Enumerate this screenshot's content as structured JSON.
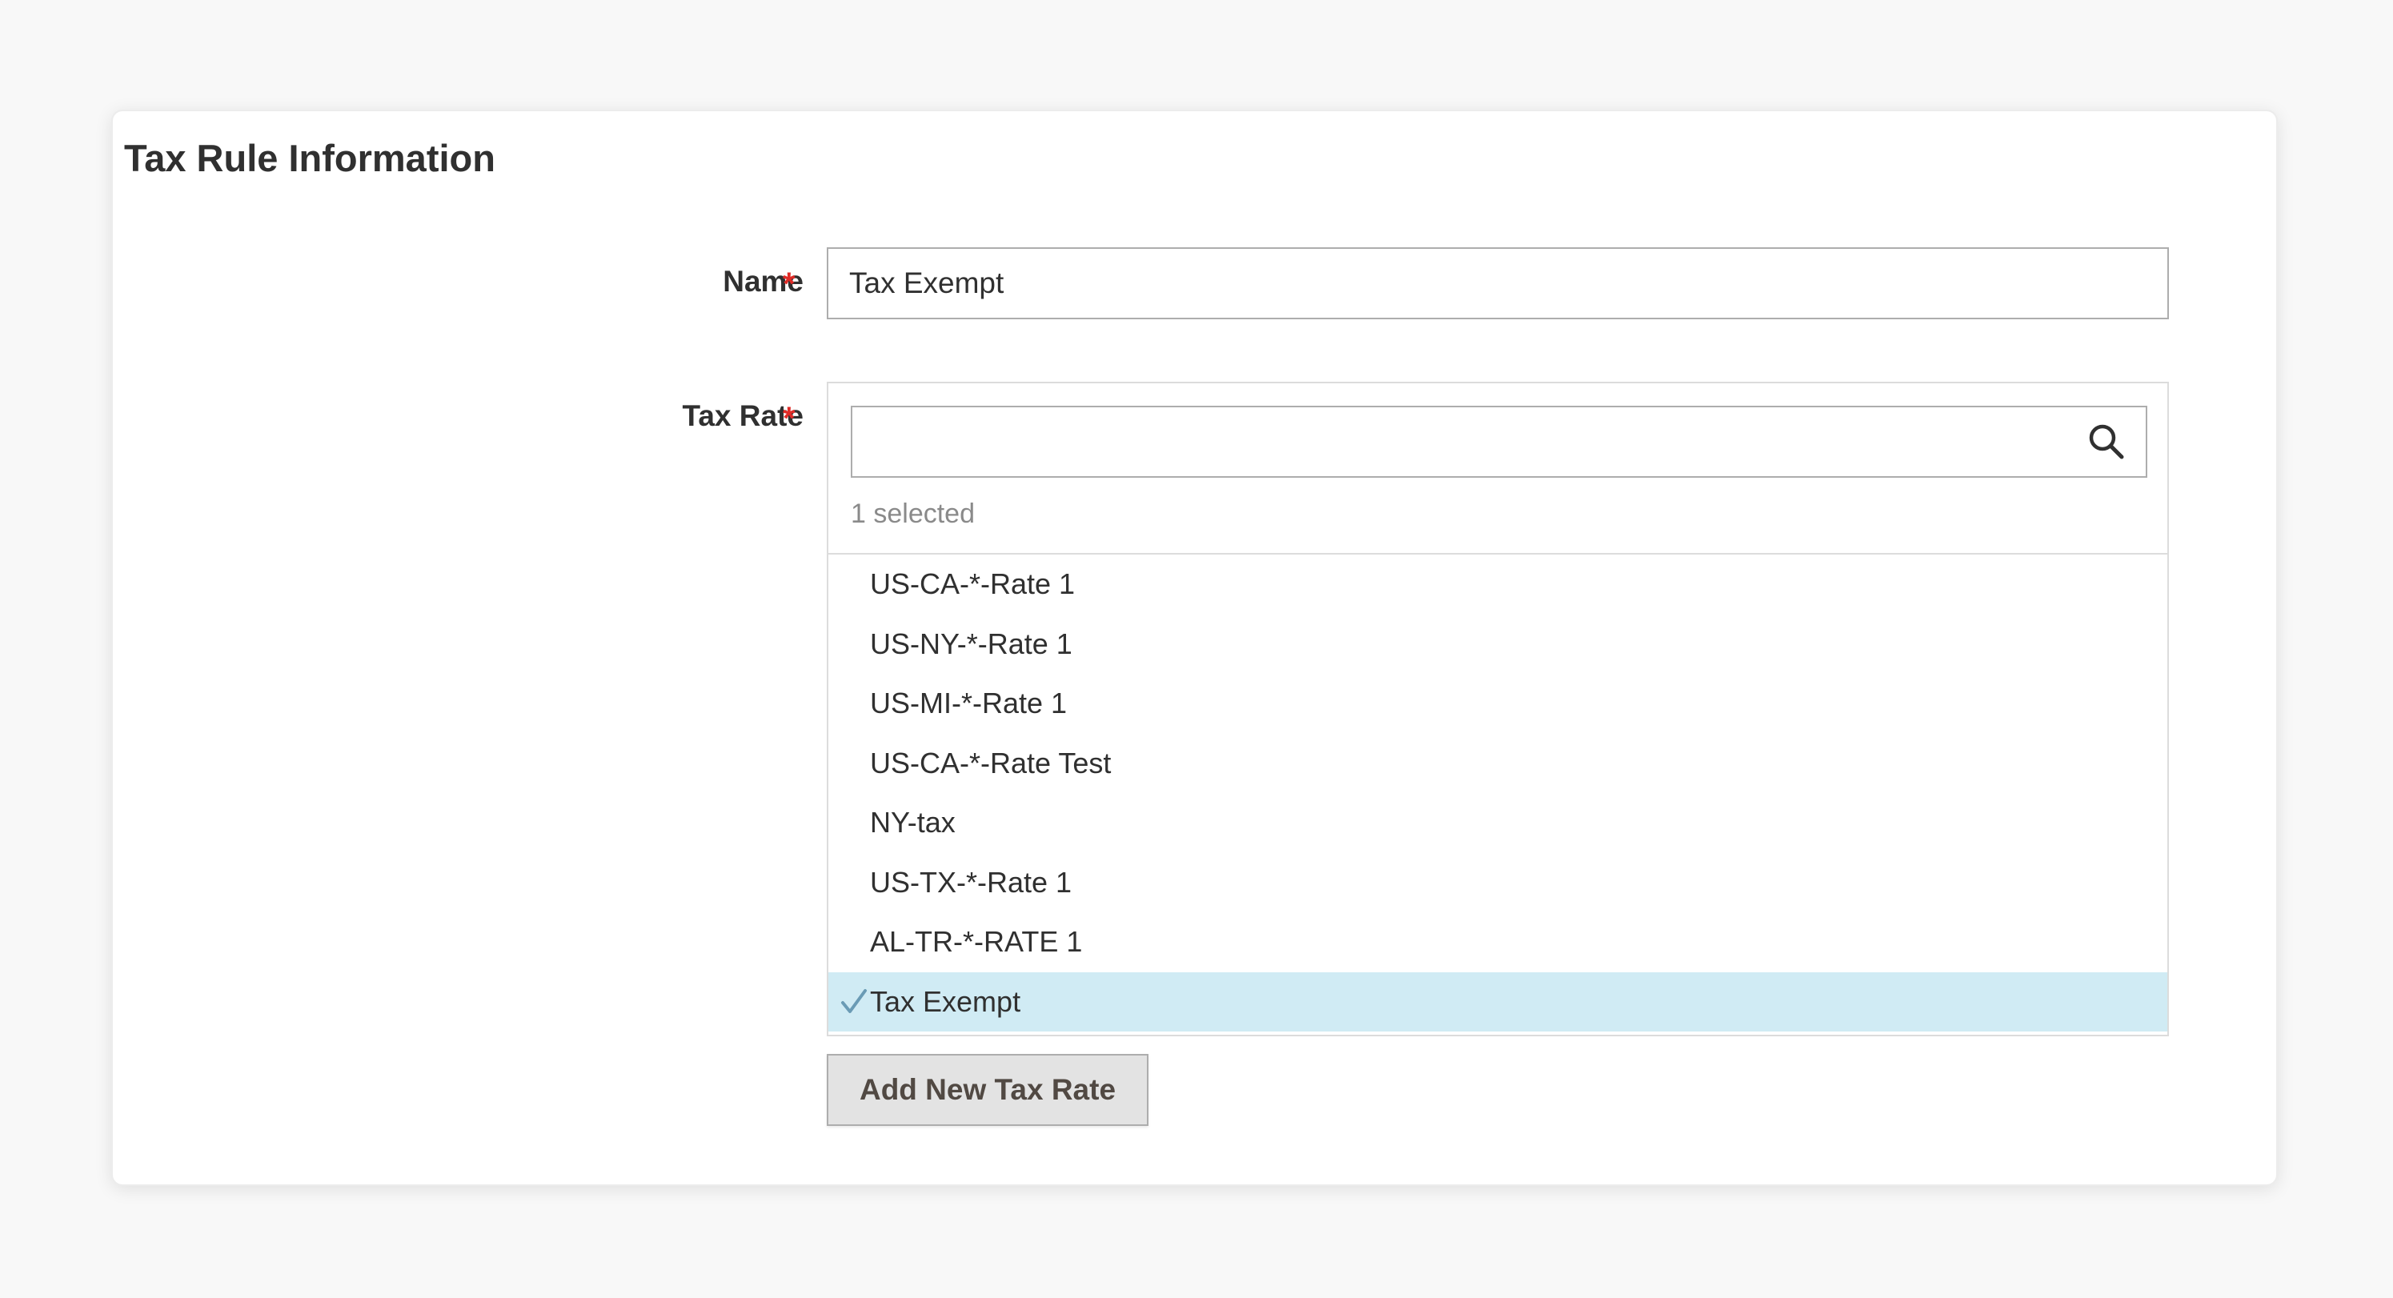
{
  "section": {
    "title": "Tax Rule Information"
  },
  "name_field": {
    "label": "Name",
    "required_mark": "*",
    "value": "Tax Exempt"
  },
  "tax_rate_field": {
    "label": "Tax Rate",
    "required_mark": "*",
    "search_placeholder": "",
    "selected_count": "1 selected",
    "options": [
      {
        "label": "US-CA-*-Rate 1",
        "selected": false
      },
      {
        "label": "US-NY-*-Rate 1",
        "selected": false
      },
      {
        "label": "US-MI-*-Rate 1",
        "selected": false
      },
      {
        "label": "US-CA-*-Rate Test",
        "selected": false
      },
      {
        "label": "NY-tax",
        "selected": false
      },
      {
        "label": "US-TX-*-Rate 1",
        "selected": false
      },
      {
        "label": "AL-TR-*-RATE 1",
        "selected": false
      },
      {
        "label": "Tax Exempt",
        "selected": true
      }
    ]
  },
  "add_button": {
    "label": "Add New Tax Rate"
  },
  "colors": {
    "required": "#e02b27",
    "selected_row": "#d0ebf4",
    "check": "#6a9bb5",
    "button_bg": "#e3e3e3"
  },
  "icons": {
    "search": "search-icon",
    "check": "check-icon"
  }
}
